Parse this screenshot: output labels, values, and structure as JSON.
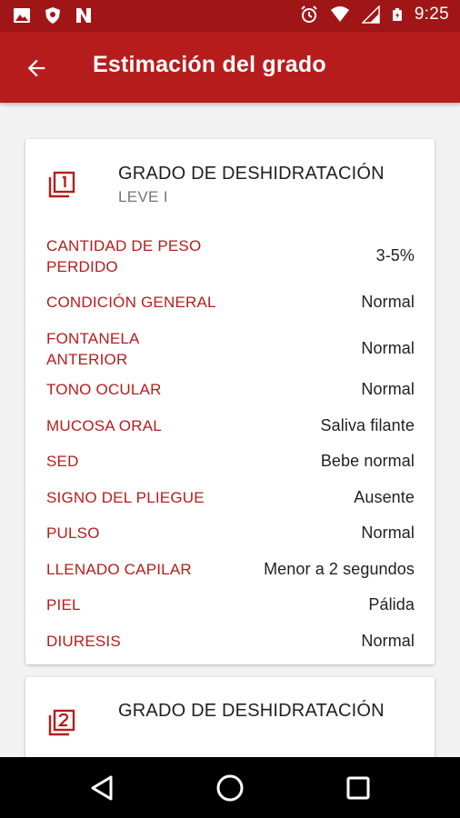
{
  "status_bar": {
    "time": "9:25",
    "left_icons": [
      "image-icon",
      "shield-icon",
      "n-icon"
    ],
    "right_icons": [
      "alarm-icon",
      "wifi-icon",
      "signal-icon",
      "battery-icon"
    ]
  },
  "app_bar": {
    "title": "Estimación del grado",
    "back_icon": "arrow-back-icon",
    "color": "#b71c1c"
  },
  "cards": [
    {
      "icon": "filter-1-icon",
      "title": "GRADO DE DESHIDRATACIÓN",
      "subtitle": "LEVE I",
      "rows": [
        {
          "label": "CANTIDAD DE PESO PERDIDO",
          "value": "3-5%"
        },
        {
          "label": "CONDICIÓN GENERAL",
          "value": "Normal"
        },
        {
          "label": "FONTANELA ANTERIOR",
          "value": "Normal"
        },
        {
          "label": "TONO OCULAR",
          "value": "Normal"
        },
        {
          "label": "MUCOSA ORAL",
          "value": "Saliva filante"
        },
        {
          "label": "SED",
          "value": "Bebe normal"
        },
        {
          "label": "SIGNO DEL PLIEGUE",
          "value": "Ausente"
        },
        {
          "label": "PULSO",
          "value": "Normal"
        },
        {
          "label": "LLENADO CAPILAR",
          "value": "Menor a 2 segundos"
        },
        {
          "label": "PIEL",
          "value": "Pálida"
        },
        {
          "label": "DIURESIS",
          "value": "Normal"
        }
      ]
    },
    {
      "icon": "filter-2-icon",
      "title": "GRADO DE DESHIDRATACIÓN"
    }
  ],
  "nav_bar": {
    "buttons": [
      "back-triangle-icon",
      "home-circle-icon",
      "recents-square-icon"
    ]
  },
  "colors": {
    "status_bar": "#a01616",
    "accent": "#b71c1c",
    "text_primary": "#212121",
    "text_secondary": "#757575"
  }
}
